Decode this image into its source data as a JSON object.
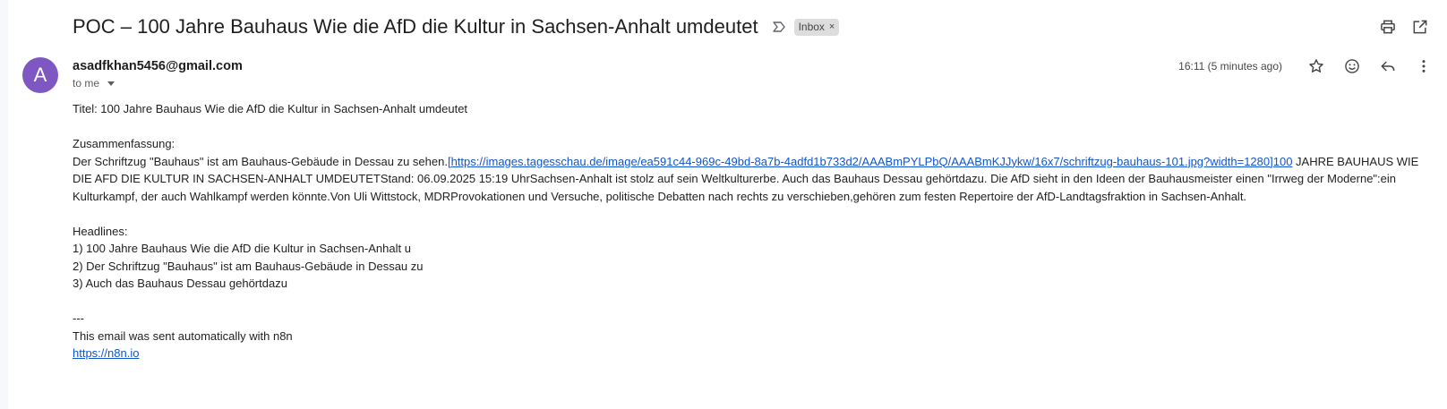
{
  "email": {
    "subject": "POC – 100 Jahre Bauhaus Wie die AfD die Kultur in Sachsen-Anhalt umdeutet",
    "label": "Inbox",
    "label_close": "×",
    "avatar_letter": "A",
    "avatar_color": "#7e57c2",
    "sender": "asadfkhan5456@gmail.com",
    "recipient": "to me",
    "timestamp": "16:11 (5 minutes ago)"
  },
  "body": {
    "titel": "Titel: 100 Jahre Bauhaus Wie die AfD die Kultur in Sachsen-Anhalt umdeutet",
    "zusammenfassung_heading": "Zusammenfassung:",
    "summary_pre": "Der Schriftzug \"Bauhaus\" ist am Bauhaus-Gebäude in Dessau zu sehen.",
    "summary_link": "[https://images.tagesschau.de/image/ea591c44-969c-49bd-8a7b-4adfd1b733d2/AAABmPYLPbQ/AAABmKJJykw/16x7/schriftzug-bauhaus-101.jpg?width=1280]100",
    "summary_post": " JAHRE BAUHAUS WIE DIE AFD DIE KULTUR IN SACHSEN-ANHALT UMDEUTETStand: 06.09.2025 15:19 UhrSachsen-Anhalt ist stolz auf sein Weltkulturerbe. Auch das Bauhaus Dessau gehörtdazu. Die AfD sieht in den Ideen der Bauhausmeister einen \"Irrweg der Moderne\":ein Kulturkampf, der auch Wahlkampf werden könnte.Von Uli Wittstock, MDRProvokationen und Versuche, politische Debatten nach rechts zu verschieben,gehören zum festen Repertoire der AfD-Landtagsfraktion in Sachsen-Anhalt.",
    "headlines_heading": "Headlines:",
    "headlines": [
      "1) 100 Jahre Bauhaus Wie die AfD die Kultur in Sachsen-Anhalt u",
      "2) Der Schriftzug \"Bauhaus\" ist am Bauhaus-Gebäude in Dessau zu",
      "3) Auch das Bauhaus Dessau gehörtdazu"
    ],
    "separator": "---",
    "footer_text": "This email was sent automatically with n8n",
    "footer_link": "https://n8n.io"
  },
  "icons": {
    "important": "important-marker-icon",
    "print": "print-icon",
    "open_new_window": "open-in-new-window-icon",
    "star": "star-icon",
    "emoji": "emoji-reaction-icon",
    "reply": "reply-icon",
    "more": "more-vertical-icon"
  }
}
